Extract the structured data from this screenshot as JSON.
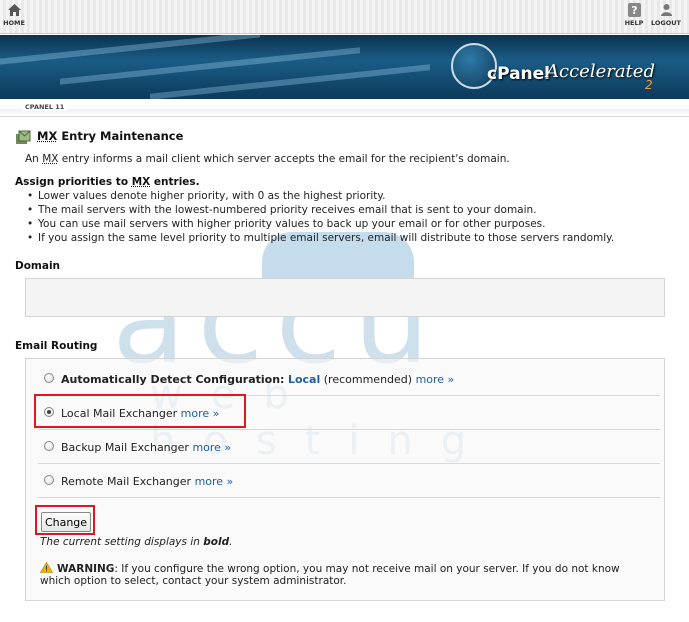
{
  "topbar": {
    "home_label": "HOME",
    "help_label": "HELP",
    "logout_label": "LOGOUT"
  },
  "banner": {
    "logo_text": "cPanel",
    "logo_text2": "Accelerated",
    "logo_sub": "2"
  },
  "breadcrumb": "CPANEL 11",
  "watermark": {
    "main": "accu",
    "sub": "web hosting"
  },
  "page": {
    "title_prefix": "MX",
    "title_rest": " Entry Maintenance",
    "intro_pre": "An ",
    "intro_mx": "MX",
    "intro_post": " entry informs a mail client which server accepts the email for the recipient's domain.",
    "assign_pre": "Assign priorities to ",
    "assign_mx": "MX",
    "assign_post": " entries.",
    "bullets": [
      "Lower values denote higher priority, with 0 as the highest priority.",
      "The mail servers with the lowest-numbered priority receives email that is sent to your domain.",
      "You can use mail servers with higher priority values to back up your email or for other purposes.",
      "If you assign the same level priority to multiple email servers, email will distribute to those servers randomly."
    ],
    "domain_heading": "Domain",
    "routing_heading": "Email Routing"
  },
  "routing": {
    "options": [
      {
        "label": "Automatically Detect Configuration:",
        "value": "Local",
        "suffix": " (recommended) ",
        "more": "more »"
      },
      {
        "label": "Local Mail Exchanger",
        "more": "more »"
      },
      {
        "label": "Backup Mail Exchanger",
        "more": "more »"
      },
      {
        "label": "Remote Mail Exchanger",
        "more": "more »"
      }
    ],
    "selected_index": 1,
    "change_button": "Change",
    "note_pre": "The current setting displays in ",
    "note_bold": "bold",
    "note_post": ".",
    "warning_label": "WARNING",
    "warning_text": ": If you configure the wrong option, you may not receive mail on your server. If you do not know which option to select, contact your system administrator."
  },
  "colors": {
    "link": "#1e5e9a",
    "highlight": "#e0181e",
    "warning_icon": "#f2b400"
  }
}
